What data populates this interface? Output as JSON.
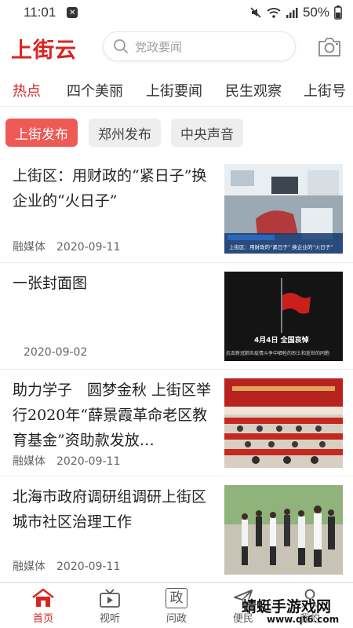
{
  "status_bar": {
    "time": "11:01",
    "battery": "50%"
  },
  "header": {
    "logo": "上街云",
    "search_placeholder": "党政要闻"
  },
  "tabs": [
    {
      "label": "热点",
      "active": true
    },
    {
      "label": "四个美丽"
    },
    {
      "label": "上街要闻"
    },
    {
      "label": "民生观察"
    },
    {
      "label": "上街号"
    }
  ],
  "filters": [
    {
      "label": "上街发布",
      "active": true
    },
    {
      "label": "郑州发布"
    },
    {
      "label": "中央声音"
    }
  ],
  "articles": [
    {
      "title": "上街区：用财政的“紧日子”换企业的“火日子”",
      "source": "融媒体",
      "date": "2020-09-11",
      "thumb_caption_1": "上街区：用财政的“紧日子” 换企业的“火日子”"
    },
    {
      "title": "一张封面图",
      "source": "",
      "date": "2020-09-02",
      "thumb_caption_1": "4月4日  全国哀悼",
      "thumb_caption_2": "抗击新冠肺炎疫情斗争中牺牲的烈士和逝世的同胞"
    },
    {
      "title": "助力学子　圆梦金秋 上街区举行2020年“薛景霞革命老区教育基金”资助款发放…",
      "source": "融媒体",
      "date": "2020-09-11"
    },
    {
      "title": "北海市政府调研组调研上街区城市社区治理工作",
      "source": "融媒体",
      "date": "2020-09-11"
    }
  ],
  "bottom_nav": [
    {
      "label": "首页",
      "icon": "home-icon",
      "active": true
    },
    {
      "label": "视听",
      "icon": "tv-icon"
    },
    {
      "label": "问政",
      "icon": "zheng-icon",
      "glyph": "政"
    },
    {
      "label": "便民",
      "icon": "send-icon"
    },
    {
      "label": "我的",
      "icon": "person-icon"
    }
  ],
  "watermark": {
    "text": "蜻蜓手游戏网",
    "url": "www.qt6.com"
  },
  "colors": {
    "brand_red": "#d9241f",
    "chip_active": "#ee5a55"
  }
}
